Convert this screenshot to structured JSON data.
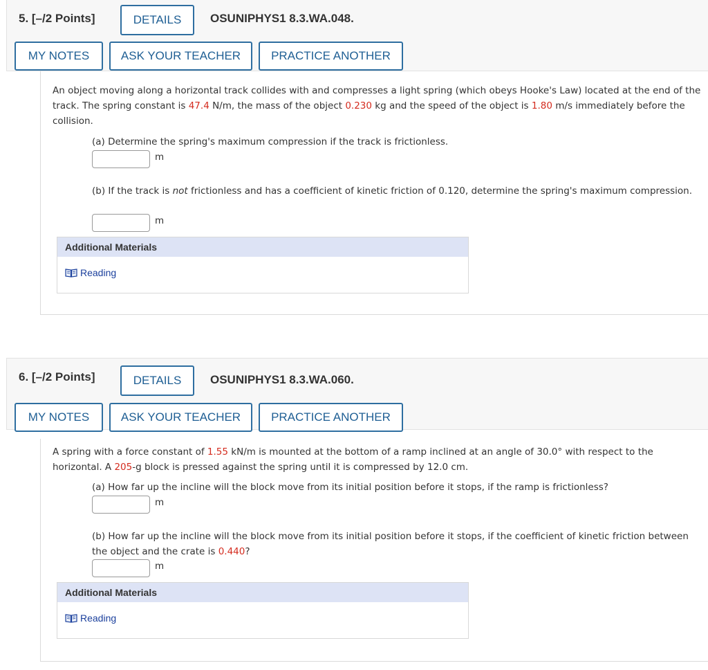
{
  "questions": [
    {
      "number_label": "5.  [–/2 Points]",
      "details_label": "DETAILS",
      "code": "OSUNIPHYS1 8.3.WA.048.",
      "my_notes_label": "MY NOTES",
      "ask_teacher_label": "ASK YOUR TEACHER",
      "practice_label": "PRACTICE ANOTHER",
      "problem": {
        "t1": "An object moving along a horizontal track collides with and compresses a light spring (which obeys Hooke's Law) located at the end of the track. The spring constant is ",
        "v1": "47.4",
        "t2": " N/m, the mass of the object ",
        "v2": "0.230",
        "t3": " kg and the speed of the object is ",
        "v3": "1.80",
        "t4": " m/s immediately before the collision."
      },
      "part_a": "(a) Determine the spring's maximum compression if the track is frictionless.",
      "part_a_value": "",
      "part_a_unit": "m",
      "part_b": {
        "t1": "(b) If the track is ",
        "em": "not",
        "t2": " frictionless and has a coefficient of kinetic friction of 0.120, determine the spring's maximum compression."
      },
      "part_b_value": "",
      "part_b_unit": "m",
      "additional_materials": "Additional Materials",
      "reading_label": "Reading"
    },
    {
      "number_label": "6.  [–/2 Points]",
      "details_label": "DETAILS",
      "code": "OSUNIPHYS1 8.3.WA.060.",
      "my_notes_label": "MY NOTES",
      "ask_teacher_label": "ASK YOUR TEACHER",
      "practice_label": "PRACTICE ANOTHER",
      "problem": {
        "t1": "A spring with a force constant of ",
        "v1": "1.55",
        "t2": " kN/m is mounted at the bottom of a ramp inclined at an angle of 30.0° with respect to the horizontal. A ",
        "v2": "205",
        "t3": "-g block is pressed against the spring until it is compressed by 12.0 cm."
      },
      "part_a": "(a) How far up the incline will the block move from its initial position before it stops, if the ramp is frictionless?",
      "part_a_value": "",
      "part_a_unit": "m",
      "part_b": {
        "t1": "(b) How far up the incline will the block move from its initial position before it stops, if the coefficient of kinetic friction between the object and the crate is ",
        "v1": "0.440",
        "t2": "?"
      },
      "part_b_value": "",
      "part_b_unit": "m",
      "additional_materials": "Additional Materials",
      "reading_label": "Reading"
    }
  ],
  "icons": {
    "reading": "book-icon"
  },
  "colors": {
    "accent": "#2e6ea0",
    "value_red": "#d42b1e",
    "link": "#1a3f9c",
    "materials_header": "#dde3f5"
  }
}
